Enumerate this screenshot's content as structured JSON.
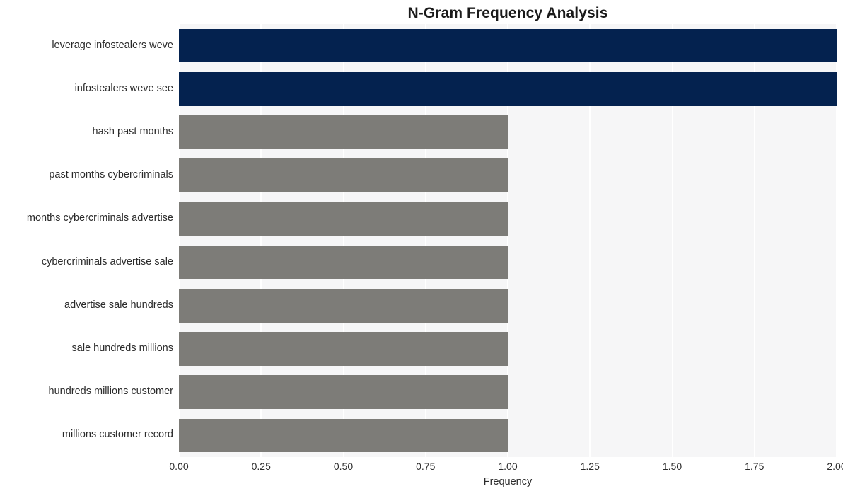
{
  "chart_data": {
    "type": "bar",
    "orientation": "horizontal",
    "title": "N-Gram Frequency Analysis",
    "xlabel": "Frequency",
    "ylabel": "",
    "xlim": [
      0.0,
      2.0
    ],
    "grid": true,
    "legend": false,
    "xticks": [
      "0.00",
      "0.25",
      "0.50",
      "0.75",
      "1.00",
      "1.25",
      "1.50",
      "1.75",
      "2.00"
    ],
    "xtick_values": [
      0.0,
      0.25,
      0.5,
      0.75,
      1.0,
      1.25,
      1.5,
      1.75,
      2.0
    ],
    "categories": [
      "leverage infostealers weve",
      "infostealers weve see",
      "hash past months",
      "past months cybercriminals",
      "months cybercriminals advertise",
      "cybercriminals advertise sale",
      "advertise sale hundreds",
      "sale hundreds millions",
      "hundreds millions customer",
      "millions customer record"
    ],
    "values": [
      2,
      2,
      1,
      1,
      1,
      1,
      1,
      1,
      1,
      1
    ],
    "bar_colors": [
      "#04224f",
      "#04224f",
      "#7d7c78",
      "#7d7c78",
      "#7d7c78",
      "#7d7c78",
      "#7d7c78",
      "#7d7c78",
      "#7d7c78",
      "#7d7c78"
    ],
    "colors": {
      "highlight": "#04224f",
      "default": "#7d7c78",
      "plot_background": "#f6f6f7",
      "gridline": "#ffffff",
      "figure_background": "#ffffff",
      "text": "#2b2b2b"
    }
  }
}
